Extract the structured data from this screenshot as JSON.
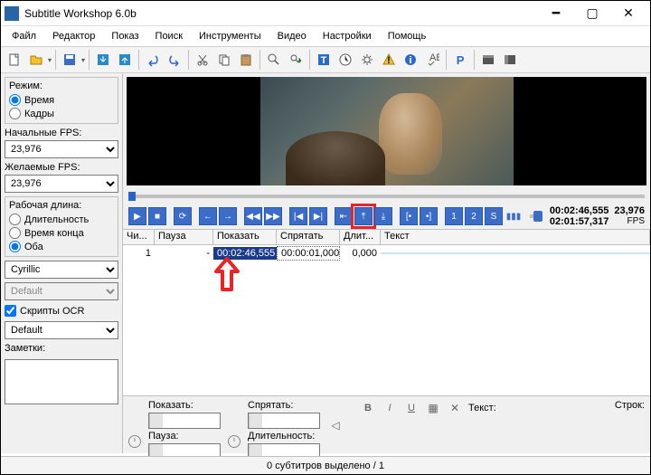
{
  "window": {
    "title": "Subtitle Workshop 6.0b"
  },
  "menu": {
    "file": "Файл",
    "edit": "Редактор",
    "view": "Показ",
    "search": "Поиск",
    "tools": "Инструменты",
    "video": "Видео",
    "settings": "Настройки",
    "help": "Помощь"
  },
  "sidebar": {
    "mode_title": "Режим:",
    "mode_time": "Время",
    "mode_frames": "Кадры",
    "input_fps_label": "Начальные FPS:",
    "input_fps_value": "23,976",
    "desired_fps_label": "Желаемые FPS:",
    "desired_fps_value": "23,976",
    "work_title": "Рабочая длина:",
    "work_duration": "Длительность",
    "work_endtime": "Время конца",
    "work_both": "Оба",
    "charset_value": "Cyrillic",
    "font_value": "Default",
    "ocr_label": "Скрипты OCR",
    "ocr_value": "Default",
    "notes_label": "Заметки:"
  },
  "timecode": {
    "current": "00:02:46,555",
    "total": "02:01:57,317",
    "fps_val": "23,976",
    "fps_lbl": "FPS"
  },
  "grid": {
    "cols": {
      "num": "Чи...",
      "pause": "Пауза",
      "show": "Показать",
      "hide": "Спрятать",
      "dur": "Длит...",
      "text": "Текст"
    },
    "row1": {
      "num": "1",
      "pause": "-",
      "show": "00:02:46,555",
      "hide": "00:00:01,000",
      "dur": "0,000",
      "text": ""
    }
  },
  "bottom": {
    "show_lbl": "Показать:",
    "hide_lbl": "Спрятать:",
    "pause_lbl": "Пауза:",
    "dur_lbl": "Длительность:",
    "text_lbl": "Текст:",
    "lines_lbl": "Строк:"
  },
  "status": {
    "text": "0 субтитров выделено / 1"
  }
}
